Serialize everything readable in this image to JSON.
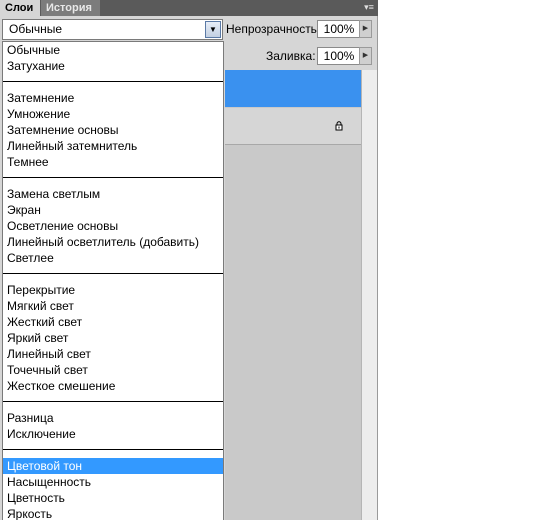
{
  "tabs": [
    {
      "label": "Слои",
      "active": true
    },
    {
      "label": "История",
      "active": false
    }
  ],
  "panel_menu_icon": "panel-menu-icon",
  "blend_mode": {
    "value": "Обычные"
  },
  "opacity": {
    "label": "Непрозрачность:",
    "value": "100%"
  },
  "fill": {
    "label": "Заливка:",
    "value": "100%"
  },
  "dropdown": {
    "groups": [
      [
        "Обычные",
        "Затухание"
      ],
      [
        "Затемнение",
        "Умножение",
        "Затемнение основы",
        "Линейный затемнитель",
        "Темнее"
      ],
      [
        "Замена светлым",
        "Экран",
        "Осветление основы",
        "Линейный осветлитель (добавить)",
        "Светлее"
      ],
      [
        "Перекрытие",
        "Мягкий свет",
        "Жесткий свет",
        "Яркий свет",
        "Линейный свет",
        "Точечный свет",
        "Жесткое смешение"
      ],
      [
        "Разница",
        "Исключение"
      ],
      [
        "Цветовой тон",
        "Насыщенность",
        "Цветность",
        "Яркость"
      ]
    ],
    "highlighted": "Цветовой тон"
  },
  "colors": {
    "selection": "#3399ff",
    "selected_layer": "#3a91ef",
    "panel_bg": "#d6d6d6"
  }
}
